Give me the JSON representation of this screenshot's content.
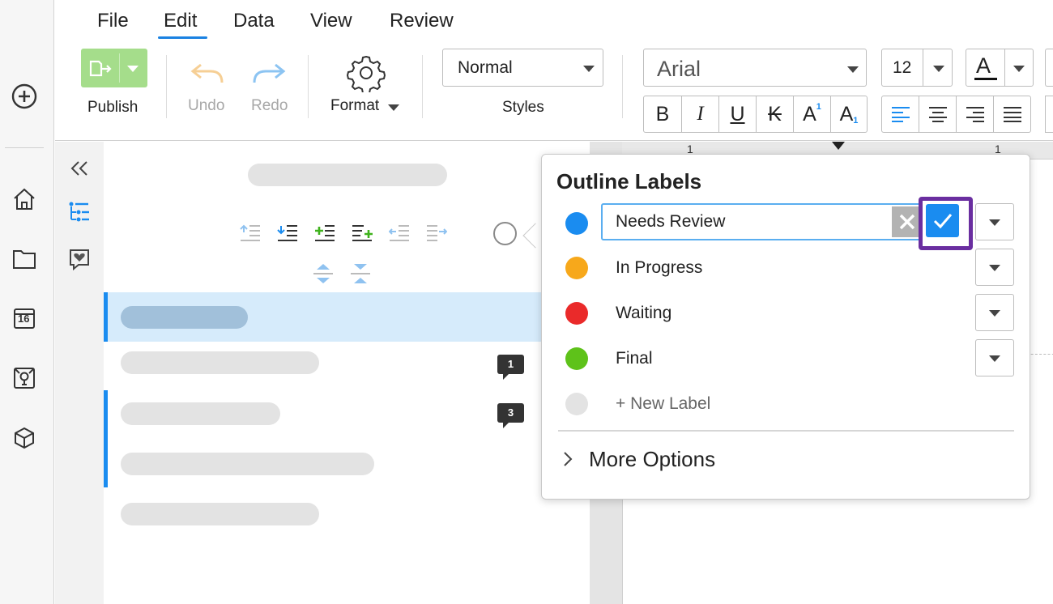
{
  "menu": {
    "items": [
      "File",
      "Edit",
      "Data",
      "View",
      "Review"
    ],
    "active": "Edit"
  },
  "toolbar": {
    "publish_label": "Publish",
    "undo_label": "Undo",
    "redo_label": "Redo",
    "format_label": "Format",
    "styles_value": "Normal",
    "styles_label": "Styles",
    "font_value": "Arial",
    "font_size_value": "12",
    "font_color_glyph": "A",
    "bold_glyph": "B",
    "italic_glyph": "I",
    "underline_glyph": "U",
    "strike_glyph": "K",
    "superscript_glyph": "A",
    "superscript_mark": "1",
    "subscript_glyph": "A",
    "subscript_mark": "1"
  },
  "rail": {
    "icons": [
      "add-icon",
      "home-icon",
      "folder-icon",
      "calendar-icon",
      "template-icon",
      "cube-icon"
    ],
    "calendar_day": "16"
  },
  "outline": {
    "comment_counts": [
      "1",
      "3"
    ]
  },
  "ruler": {
    "ticks": [
      "1",
      "1"
    ]
  },
  "popover": {
    "title": "Outline Labels",
    "editing_value": "Needs Review",
    "labels": [
      {
        "name": "Needs Review",
        "color": "#1a8cf0"
      },
      {
        "name": "In Progress",
        "color": "#f7a81b"
      },
      {
        "name": "Waiting",
        "color": "#ea2a2a"
      },
      {
        "name": "Final",
        "color": "#5ec21a"
      }
    ],
    "new_label": "+ New Label",
    "more_options": "More Options"
  },
  "colors": {
    "accent": "#1a8cf0",
    "publish_green": "#a5dd8b",
    "highlight_purple": "#6a2ea0"
  }
}
